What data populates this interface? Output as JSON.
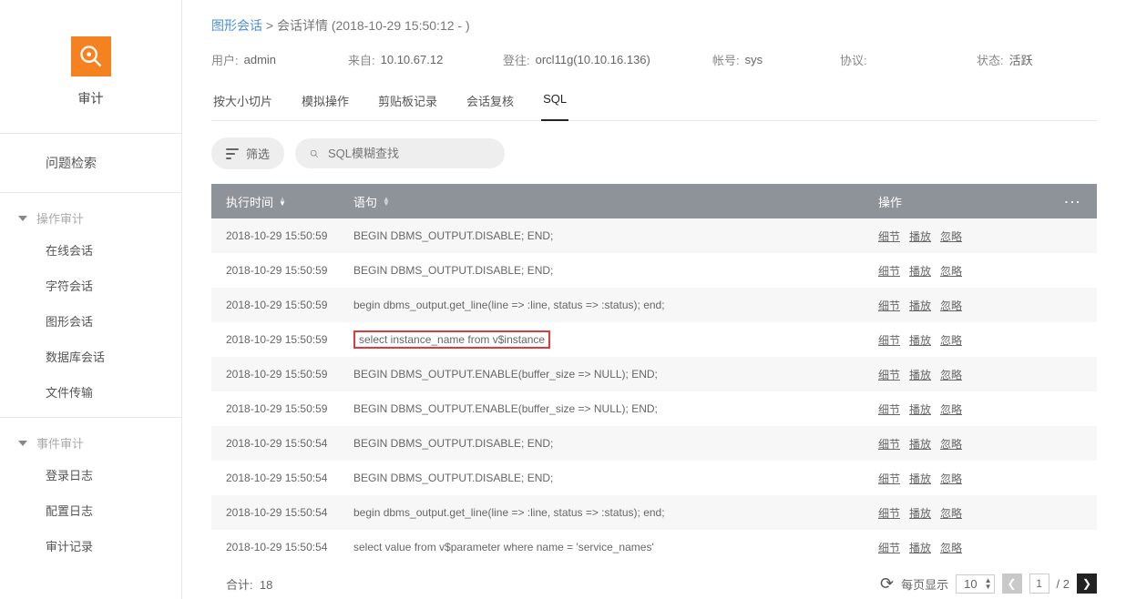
{
  "sidebar": {
    "title": "审计",
    "single": "问题检索",
    "group1": {
      "header": "操作审计",
      "items": [
        "在线会话",
        "字符会话",
        "图形会话",
        "数据库会话",
        "文件传输"
      ]
    },
    "group2": {
      "header": "事件审计",
      "items": [
        "登录日志",
        "配置日志",
        "审计记录"
      ]
    }
  },
  "breadcrumb": {
    "link": "图形会话",
    "sep": ">",
    "current": "会话详情 (2018-10-29 15:50:12 - )"
  },
  "meta": {
    "user": {
      "label": "用户:",
      "value": "admin"
    },
    "from": {
      "label": "来自:",
      "value": "10.10.67.12"
    },
    "login": {
      "label": "登往:",
      "value": "orcl11g(10.10.16.136)"
    },
    "acct": {
      "label": "帐号:",
      "value": "sys"
    },
    "proto": {
      "label": "协议:",
      "value": ""
    },
    "status": {
      "label": "状态:",
      "value": "活跃"
    }
  },
  "tabs": [
    "按大小切片",
    "模拟操作",
    "剪贴板记录",
    "会话复核",
    "SQL"
  ],
  "active_tab": 4,
  "filter": {
    "button": "筛选",
    "placeholder": "SQL模糊查找"
  },
  "table": {
    "headers": {
      "time": "执行时间",
      "stmt": "语句",
      "ops": "操作"
    },
    "ops_labels": [
      "细节",
      "播放",
      "忽略"
    ],
    "highlight_index": 3,
    "rows": [
      {
        "time": "2018-10-29 15:50:59",
        "stmt": "BEGIN DBMS_OUTPUT.DISABLE; END;"
      },
      {
        "time": "2018-10-29 15:50:59",
        "stmt": "BEGIN DBMS_OUTPUT.DISABLE; END;"
      },
      {
        "time": "2018-10-29 15:50:59",
        "stmt": "begin dbms_output.get_line(line => :line, status => :status); end;"
      },
      {
        "time": "2018-10-29 15:50:59",
        "stmt": "select instance_name from v$instance"
      },
      {
        "time": "2018-10-29 15:50:59",
        "stmt": "BEGIN DBMS_OUTPUT.ENABLE(buffer_size => NULL); END;"
      },
      {
        "time": "2018-10-29 15:50:59",
        "stmt": "BEGIN DBMS_OUTPUT.ENABLE(buffer_size => NULL); END;"
      },
      {
        "time": "2018-10-29 15:50:54",
        "stmt": "BEGIN DBMS_OUTPUT.DISABLE; END;"
      },
      {
        "time": "2018-10-29 15:50:54",
        "stmt": "BEGIN DBMS_OUTPUT.DISABLE; END;"
      },
      {
        "time": "2018-10-29 15:50:54",
        "stmt": "begin dbms_output.get_line(line => :line, status => :status); end;"
      },
      {
        "time": "2018-10-29 15:50:54",
        "stmt": "select value from v$parameter where name = 'service_names'"
      }
    ]
  },
  "footer": {
    "total_label": "合计:",
    "total": "18",
    "per_page_label": "每页显示",
    "per_page": "10",
    "current_page": "1",
    "total_pages": "/ 2"
  }
}
